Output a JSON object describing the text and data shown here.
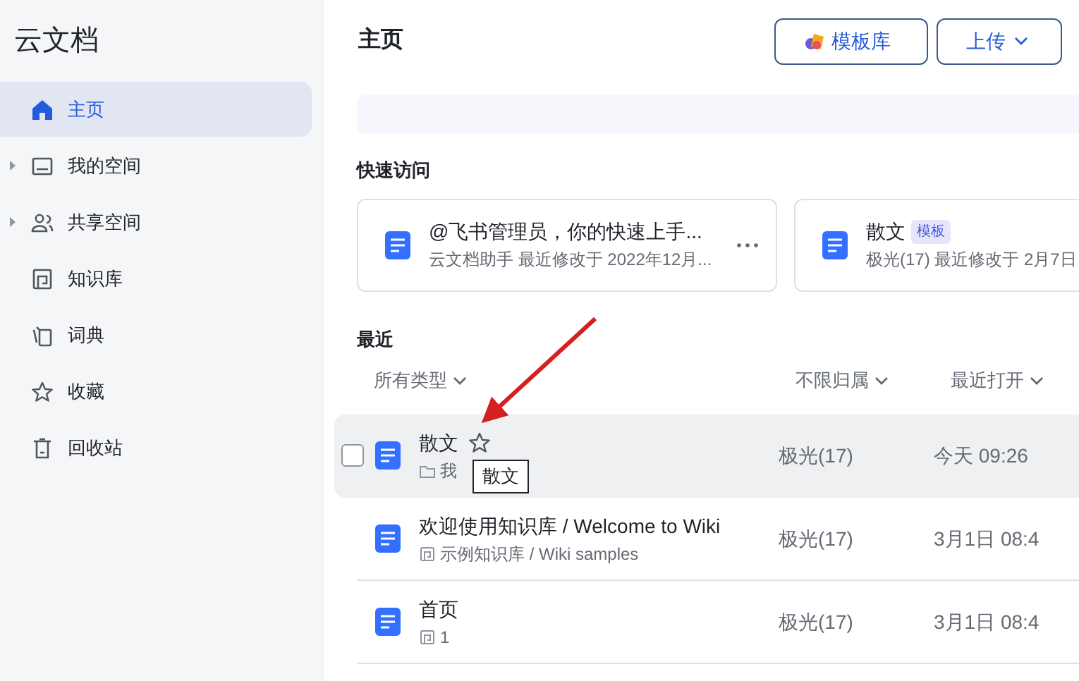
{
  "app_title": "云文档",
  "sidebar": {
    "items": [
      {
        "label": "主页",
        "selected": true,
        "expandable": false
      },
      {
        "label": "我的空间",
        "selected": false,
        "expandable": true
      },
      {
        "label": "共享空间",
        "selected": false,
        "expandable": true
      },
      {
        "label": "知识库",
        "selected": false,
        "expandable": false
      },
      {
        "label": "词典",
        "selected": false,
        "expandable": false
      },
      {
        "label": "收藏",
        "selected": false,
        "expandable": false
      },
      {
        "label": "回收站",
        "selected": false,
        "expandable": false
      }
    ]
  },
  "header": {
    "title": "主页",
    "buttons": [
      {
        "label": "模板库",
        "kind": "templates"
      },
      {
        "label": "上传",
        "kind": "dropdown"
      }
    ]
  },
  "quick_access": {
    "title": "快速访问",
    "cards": [
      {
        "title": "@飞书管理员，你的快速上手...",
        "subtitle": "云文档助手 最近修改于 2022年12月..."
      },
      {
        "title": "散文",
        "tag": "模板",
        "subtitle": "极光(17) 最近修改于 2月7日"
      }
    ]
  },
  "recent": {
    "title": "最近",
    "filters": [
      "所有类型",
      "不限归属",
      "最近打开"
    ],
    "rows": [
      {
        "name": "散文",
        "location": "我",
        "owner": "极光(17)",
        "opened": "今天 09:26",
        "hovered": true,
        "tooltip": "散文"
      },
      {
        "name": "欢迎使用知识库 / Welcome to Wiki",
        "location": "示例知识库 / Wiki samples",
        "owner": "极光(17)",
        "opened": "3月1日 08:4",
        "hovered": false
      },
      {
        "name": "首页",
        "location": "1",
        "owner": "极光(17)",
        "opened": "3月1日 08:4",
        "hovered": false
      }
    ]
  }
}
